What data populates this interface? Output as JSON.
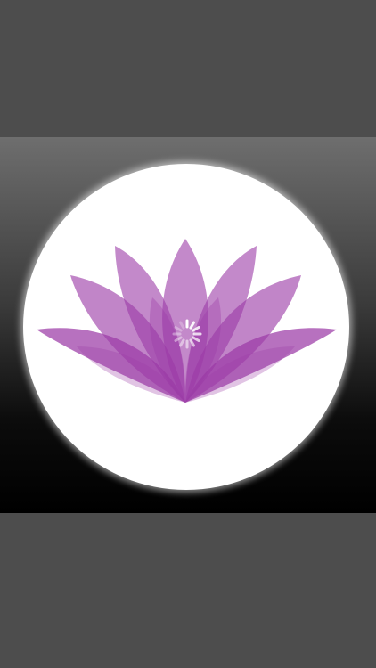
{
  "splash": {
    "logo_icon": "lotus-flower-icon",
    "loading_icon": "activity-spinner-icon",
    "colors": {
      "outer_bars": "#4d4d4d",
      "disc": "#ffffff",
      "petal": "#9b3aa6",
      "spinner": "#ffffff"
    }
  }
}
